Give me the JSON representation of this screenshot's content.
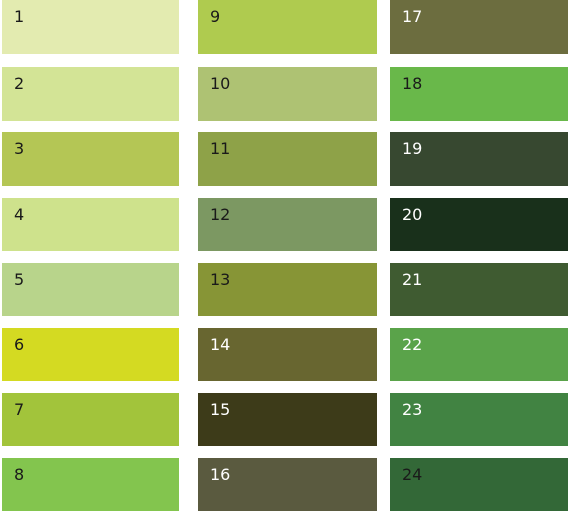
{
  "swatches": [
    {
      "label": "1",
      "color": "#e3ebb0",
      "text_color": "dark"
    },
    {
      "label": "2",
      "color": "#d3e496",
      "text_color": "dark"
    },
    {
      "label": "3",
      "color": "#b4c655",
      "text_color": "dark"
    },
    {
      "label": "4",
      "color": "#cee28c",
      "text_color": "dark"
    },
    {
      "label": "5",
      "color": "#b8d48b",
      "text_color": "dark"
    },
    {
      "label": "6",
      "color": "#d4da22",
      "text_color": "dark"
    },
    {
      "label": "7",
      "color": "#a2c43b",
      "text_color": "dark"
    },
    {
      "label": "8",
      "color": "#83c54e",
      "text_color": "dark"
    },
    {
      "label": "9",
      "color": "#afcb4f",
      "text_color": "dark"
    },
    {
      "label": "10",
      "color": "#aec273",
      "text_color": "dark"
    },
    {
      "label": "11",
      "color": "#8ea248",
      "text_color": "dark"
    },
    {
      "label": "12",
      "color": "#7c9862",
      "text_color": "dark"
    },
    {
      "label": "13",
      "color": "#879536",
      "text_color": "dark"
    },
    {
      "label": "14",
      "color": "#686630",
      "text_color": "light"
    },
    {
      "label": "15",
      "color": "#3d3b19",
      "text_color": "light"
    },
    {
      "label": "16",
      "color": "#5a5a3f",
      "text_color": "light"
    },
    {
      "label": "17",
      "color": "#6c6d3f",
      "text_color": "light"
    },
    {
      "label": "18",
      "color": "#69b84a",
      "text_color": "dark"
    },
    {
      "label": "19",
      "color": "#374830",
      "text_color": "light"
    },
    {
      "label": "20",
      "color": "#19301b",
      "text_color": "light"
    },
    {
      "label": "21",
      "color": "#3f5b31",
      "text_color": "light"
    },
    {
      "label": "22",
      "color": "#5aa34a",
      "text_color": "light"
    },
    {
      "label": "23",
      "color": "#418342",
      "text_color": "light"
    },
    {
      "label": "24",
      "color": "#336837",
      "text_color": "dark"
    }
  ]
}
